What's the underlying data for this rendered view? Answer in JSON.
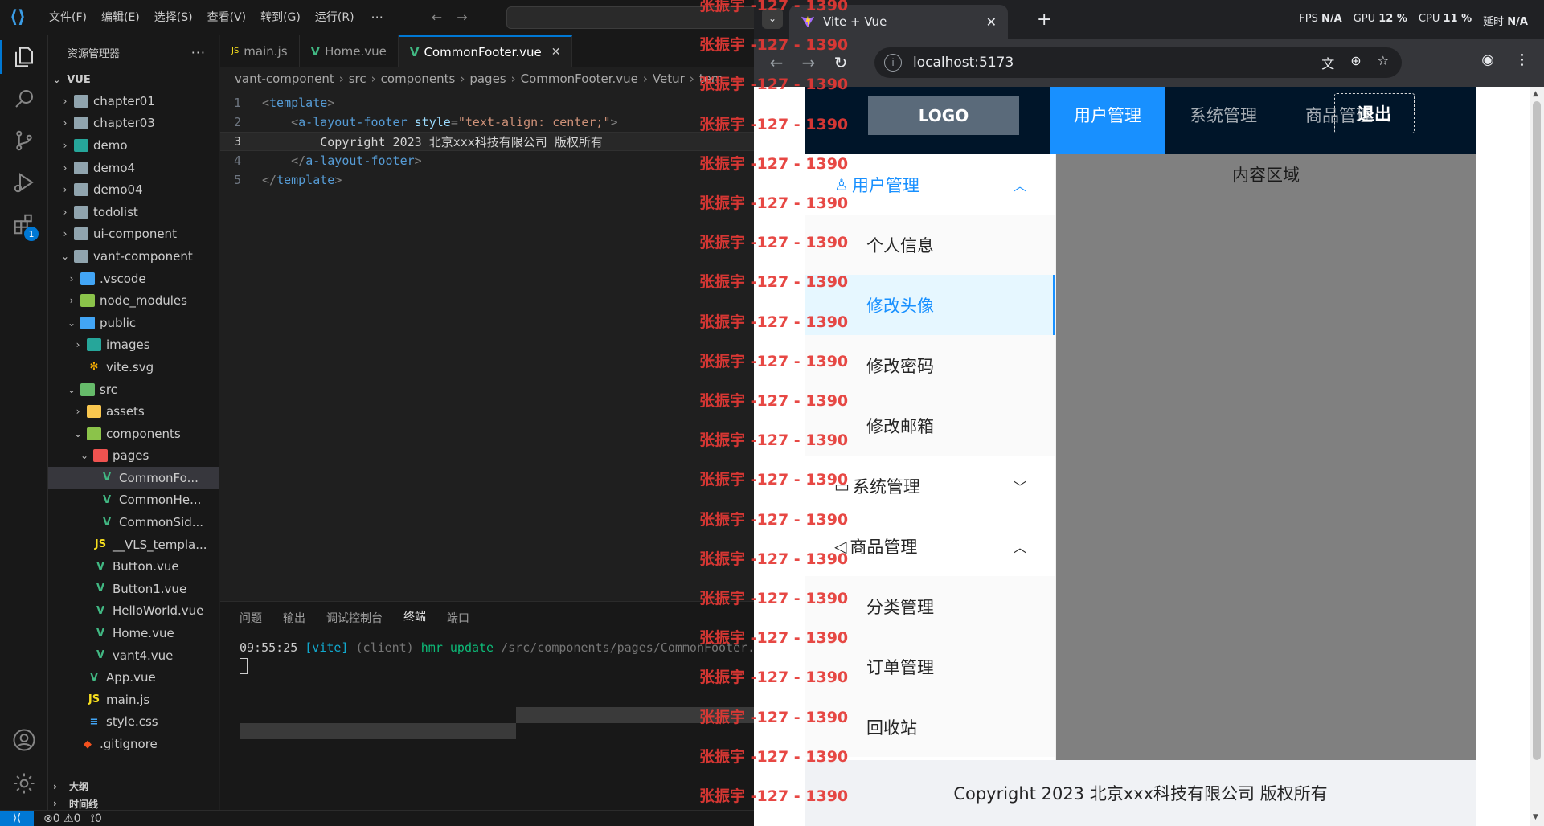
{
  "vscode": {
    "menu": [
      "文件(F)",
      "编辑(E)",
      "选择(S)",
      "查看(V)",
      "转到(G)",
      "运行(R)"
    ],
    "menu_more": "···",
    "activity_badge": "1",
    "explorer": {
      "title": "资源管理器",
      "more": "···",
      "root": "VUE",
      "tree": [
        {
          "label": "chapter01",
          "depth": 0,
          "chev": "›",
          "icon": "folder",
          "color": "gray"
        },
        {
          "label": "chapter03",
          "depth": 0,
          "chev": "›",
          "icon": "folder",
          "color": "gray"
        },
        {
          "label": "demo",
          "depth": 0,
          "chev": "›",
          "icon": "folder",
          "color": "teal"
        },
        {
          "label": "demo4",
          "depth": 0,
          "chev": "›",
          "icon": "folder",
          "color": "gray"
        },
        {
          "label": "demo04",
          "depth": 0,
          "chev": "›",
          "icon": "folder",
          "color": "gray"
        },
        {
          "label": "todolist",
          "depth": 0,
          "chev": "›",
          "icon": "folder",
          "color": "gray"
        },
        {
          "label": "ui-component",
          "depth": 0,
          "chev": "›",
          "icon": "folder",
          "color": "gray"
        },
        {
          "label": "vant-component",
          "depth": 0,
          "chev": "⌄",
          "icon": "folder",
          "color": "gray"
        },
        {
          "label": ".vscode",
          "depth": 1,
          "chev": "›",
          "icon": "folder",
          "color": "blue"
        },
        {
          "label": "node_modules",
          "depth": 1,
          "chev": "›",
          "icon": "folder",
          "color": "lime"
        },
        {
          "label": "public",
          "depth": 1,
          "chev": "⌄",
          "icon": "folder",
          "color": "blue"
        },
        {
          "label": "images",
          "depth": 2,
          "chev": "›",
          "icon": "folder",
          "color": "teal"
        },
        {
          "label": "vite.svg",
          "depth": 2,
          "chev": "",
          "icon": "star",
          "color": ""
        },
        {
          "label": "src",
          "depth": 1,
          "chev": "⌄",
          "icon": "folder",
          "color": "green"
        },
        {
          "label": "assets",
          "depth": 2,
          "chev": "›",
          "icon": "folder",
          "color": "yellow"
        },
        {
          "label": "components",
          "depth": 2,
          "chev": "⌄",
          "icon": "folder",
          "color": "lime"
        },
        {
          "label": "pages",
          "depth": 3,
          "chev": "⌄",
          "icon": "folder",
          "color": "red"
        },
        {
          "label": "CommonFo...",
          "depth": 4,
          "chev": "",
          "icon": "vue",
          "color": "",
          "selected": true
        },
        {
          "label": "CommonHe...",
          "depth": 4,
          "chev": "",
          "icon": "vue",
          "color": ""
        },
        {
          "label": "CommonSid...",
          "depth": 4,
          "chev": "",
          "icon": "vue",
          "color": ""
        },
        {
          "label": "__VLS_templa...",
          "depth": 3,
          "chev": "",
          "icon": "js",
          "color": ""
        },
        {
          "label": "Button.vue",
          "depth": 3,
          "chev": "",
          "icon": "vue",
          "color": ""
        },
        {
          "label": "Button1.vue",
          "depth": 3,
          "chev": "",
          "icon": "vue",
          "color": ""
        },
        {
          "label": "HelloWorld.vue",
          "depth": 3,
          "chev": "",
          "icon": "vue",
          "color": ""
        },
        {
          "label": "Home.vue",
          "depth": 3,
          "chev": "",
          "icon": "vue",
          "color": ""
        },
        {
          "label": "vant4.vue",
          "depth": 3,
          "chev": "",
          "icon": "vue",
          "color": ""
        },
        {
          "label": "App.vue",
          "depth": 2,
          "chev": "",
          "icon": "vue",
          "color": ""
        },
        {
          "label": "main.js",
          "depth": 2,
          "chev": "",
          "icon": "js",
          "color": ""
        },
        {
          "label": "style.css",
          "depth": 2,
          "chev": "",
          "icon": "css",
          "color": ""
        },
        {
          "label": ".gitignore",
          "depth": 1,
          "chev": "",
          "icon": "git",
          "color": ""
        }
      ],
      "outline_label": "大纲",
      "timeline_label": "时间线"
    },
    "tabs": [
      {
        "label": "main.js",
        "icon": "js",
        "active": false
      },
      {
        "label": "Home.vue",
        "icon": "vue",
        "active": false
      },
      {
        "label": "CommonFooter.vue",
        "icon": "vue",
        "active": true
      }
    ],
    "tab_close": "✕",
    "breadcrumb": [
      "vant-component",
      "src",
      "components",
      "pages",
      "CommonFooter.vue",
      "Vetur",
      "tem"
    ],
    "code": [
      {
        "n": "1",
        "tokens": [
          [
            "p",
            "<"
          ],
          [
            "t",
            "template"
          ],
          [
            "p",
            ">"
          ]
        ]
      },
      {
        "n": "2",
        "tokens": [
          [
            "x",
            "    "
          ],
          [
            "p",
            "<"
          ],
          [
            "t",
            "a-layout-footer"
          ],
          [
            "x",
            " "
          ],
          [
            "a",
            "style"
          ],
          [
            "p",
            "="
          ],
          [
            "s",
            "\"text-align: center;\""
          ],
          [
            "p",
            ">"
          ]
        ]
      },
      {
        "n": "3",
        "tokens": [
          [
            "x",
            "        Copyright 2023 北京xxx科技有限公司 版权所有"
          ]
        ],
        "current": true
      },
      {
        "n": "4",
        "tokens": [
          [
            "x",
            "    "
          ],
          [
            "p",
            "</"
          ],
          [
            "t",
            "a-layout-footer"
          ],
          [
            "p",
            ">"
          ]
        ]
      },
      {
        "n": "5",
        "tokens": [
          [
            "p",
            "</"
          ],
          [
            "t",
            "template"
          ],
          [
            "p",
            ">"
          ]
        ]
      }
    ],
    "panel_tabs": [
      "问题",
      "输出",
      "调试控制台",
      "终端",
      "端口"
    ],
    "panel_active": "终端",
    "terminal": {
      "time": "09:55:25",
      "tag": "[vite]",
      "client": "(client)",
      "event": "hmr update",
      "path": "/src/components/pages/CommonFooter.vue"
    },
    "status": {
      "errors": "0",
      "warnings": "0",
      "ports": "0",
      "remote_icon": "⟩⟨"
    }
  },
  "chrome": {
    "tab_title": "Vite + Vue",
    "tab_close": "✕",
    "new_tab": "+",
    "perf": [
      {
        "label": "FPS",
        "value": "N/A"
      },
      {
        "label": "GPU",
        "value": "12 %"
      },
      {
        "label": "CPU",
        "value": "11 %"
      },
      {
        "label": "延时",
        "value": "N/A"
      }
    ],
    "url": "localhost:5173"
  },
  "app": {
    "logo": "LOGO",
    "top_menu": [
      "用户管理",
      "系统管理",
      "商品管理"
    ],
    "top_active": "用户管理",
    "logout": "退出",
    "side_menu": [
      {
        "title": "用户管理",
        "icon": "user-icon",
        "glyph": "♙",
        "open": true,
        "arrow": "︿",
        "items": [
          "个人信息",
          "修改头像",
          "修改密码",
          "修改邮箱"
        ]
      },
      {
        "title": "系统管理",
        "icon": "laptop-icon",
        "glyph": "▭",
        "open": false,
        "arrow": "﹀",
        "items": []
      },
      {
        "title": "商品管理",
        "icon": "notification-icon",
        "glyph": "◁",
        "open": true,
        "arrow": "︿",
        "items": [
          "分类管理",
          "订单管理",
          "回收站"
        ]
      }
    ],
    "side_selected": "修改头像",
    "content_text": "内容区域",
    "footer_text": "Copyright 2023 北京xxx科技有限公司 版权所有"
  },
  "watermark": {
    "text": "张振宇 -127 - 1390"
  },
  "colors": {
    "vscode_bg": "#1f1f1f",
    "vscode_accent": "#0078d4",
    "antd_primary": "#1890ff",
    "antd_header": "#001529",
    "content_gray": "#808080",
    "watermark_red": "#e53935"
  }
}
